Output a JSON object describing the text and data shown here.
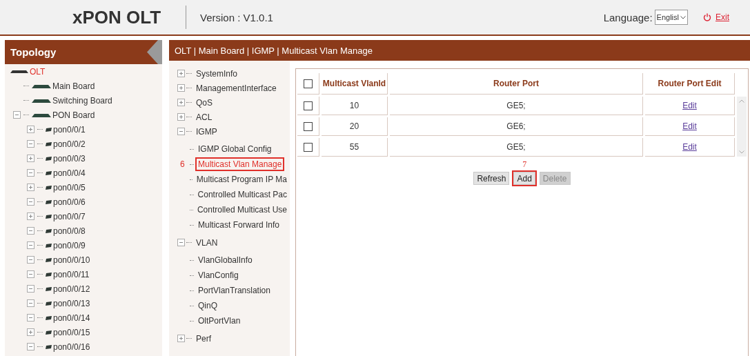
{
  "header": {
    "logo": "xPON OLT",
    "version": "Version : V1.0.1",
    "language_label": "Language:",
    "language_value": "Englisl",
    "exit": "Exit"
  },
  "topology": {
    "title": "Topology",
    "tree": [
      {
        "label": "OLT",
        "kind": "chassis",
        "selected": true,
        "children": [
          {
            "label": "Main Board",
            "kind": "board",
            "selected": false
          },
          {
            "label": "Switching Board",
            "kind": "board",
            "selected": false
          },
          {
            "label": "PON Board",
            "kind": "board",
            "selected": false,
            "expanded": true,
            "children": [
              {
                "label": "pon0/0/1",
                "kind": "port",
                "selected": false,
                "expanded": false
              },
              {
                "label": "pon0/0/2",
                "kind": "port",
                "selected": false,
                "expanded": true
              },
              {
                "label": "pon0/0/3",
                "kind": "port",
                "selected": false,
                "expanded": false
              },
              {
                "label": "pon0/0/4",
                "kind": "port",
                "selected": false,
                "expanded": true
              },
              {
                "label": "pon0/0/5",
                "kind": "port",
                "selected": false,
                "expanded": false
              },
              {
                "label": "pon0/0/6",
                "kind": "port",
                "selected": false,
                "expanded": true
              },
              {
                "label": "pon0/0/7",
                "kind": "port",
                "selected": false,
                "expanded": false
              },
              {
                "label": "pon0/0/8",
                "kind": "port",
                "selected": false,
                "expanded": true
              },
              {
                "label": "pon0/0/9",
                "kind": "port",
                "selected": false,
                "expanded": true
              },
              {
                "label": "pon0/0/10",
                "kind": "port",
                "selected": false,
                "expanded": true
              },
              {
                "label": "pon0/0/11",
                "kind": "port",
                "selected": false,
                "expanded": true
              },
              {
                "label": "pon0/0/12",
                "kind": "port",
                "selected": false,
                "expanded": true
              },
              {
                "label": "pon0/0/13",
                "kind": "port",
                "selected": false,
                "expanded": true
              },
              {
                "label": "pon0/0/14",
                "kind": "port",
                "selected": false,
                "expanded": true
              },
              {
                "label": "pon0/0/15",
                "kind": "port",
                "selected": false,
                "expanded": false
              },
              {
                "label": "pon0/0/16",
                "kind": "port",
                "selected": false,
                "expanded": true
              }
            ]
          }
        ]
      }
    ]
  },
  "breadcrumb": "OLT | Main Board | IGMP | Multicast Vlan Manage",
  "menu": [
    {
      "label": "SystemInfo",
      "expanded": false
    },
    {
      "label": "ManagementInterface",
      "expanded": false
    },
    {
      "label": "QoS",
      "expanded": false
    },
    {
      "label": "ACL",
      "expanded": false
    },
    {
      "label": "IGMP",
      "expanded": true,
      "children": [
        {
          "label": "IGMP Global Config",
          "selected": false
        },
        {
          "label": "Multicast Vlan Manage",
          "selected": true,
          "step": "6"
        },
        {
          "label": "Multicast Program IP Ma",
          "selected": false
        },
        {
          "label": "Controlled Multicast Pac",
          "selected": false
        },
        {
          "label": "Controlled Multicast Use",
          "selected": false
        },
        {
          "label": "Multicast Forward Info",
          "selected": false
        }
      ]
    },
    {
      "label": "VLAN",
      "expanded": true,
      "children": [
        {
          "label": "VlanGlobalInfo",
          "selected": false
        },
        {
          "label": "VlanConfig",
          "selected": false
        },
        {
          "label": "PortVlanTranslation",
          "selected": false
        },
        {
          "label": "QinQ",
          "selected": false
        },
        {
          "label": "OltPortVlan",
          "selected": false
        }
      ]
    },
    {
      "label": "Perf",
      "expanded": false
    }
  ],
  "table": {
    "all_checked": false,
    "columns": [
      "Multicast VlanId",
      "Router Port",
      "Router Port Edit"
    ],
    "rows": [
      {
        "checked": false,
        "vlan_id": "10",
        "router_port": "GE5;",
        "edit": "Edit"
      },
      {
        "checked": false,
        "vlan_id": "20",
        "router_port": "GE6;",
        "edit": "Edit"
      },
      {
        "checked": false,
        "vlan_id": "55",
        "router_port": "GE5;",
        "edit": "Edit"
      }
    ]
  },
  "buttons": [
    {
      "label": "Refresh",
      "disabled": false,
      "highlighted": false
    },
    {
      "label": "Add",
      "disabled": false,
      "highlighted": true,
      "step": "7"
    },
    {
      "label": "Delete",
      "disabled": true,
      "highlighted": false
    }
  ]
}
